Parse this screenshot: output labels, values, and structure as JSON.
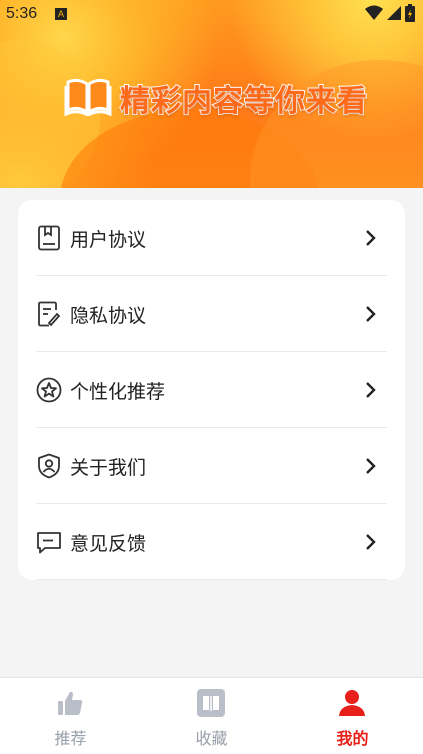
{
  "status_bar": {
    "time": "5:36",
    "notification_badge": "A"
  },
  "banner": {
    "slogan": "精彩内容等你来看",
    "icon": "open-book-icon"
  },
  "menu": {
    "items": [
      {
        "label": "用户协议",
        "icon": "agreement-icon"
      },
      {
        "label": "隐私协议",
        "icon": "privacy-document-icon"
      },
      {
        "label": "个性化推荐",
        "icon": "star-badge-icon"
      },
      {
        "label": "关于我们",
        "icon": "shield-user-icon"
      },
      {
        "label": "意见反馈",
        "icon": "feedback-message-icon"
      }
    ]
  },
  "tabs": [
    {
      "label": "推荐",
      "icon": "thumbs-up-icon",
      "active": false
    },
    {
      "label": "收藏",
      "icon": "bookshelf-icon",
      "active": false
    },
    {
      "label": "我的",
      "icon": "profile-icon",
      "active": true
    }
  ],
  "colors": {
    "accent": "#e8201a",
    "inactive_tab": "#9aa0ab",
    "banner_orange": "#ff7a18"
  }
}
